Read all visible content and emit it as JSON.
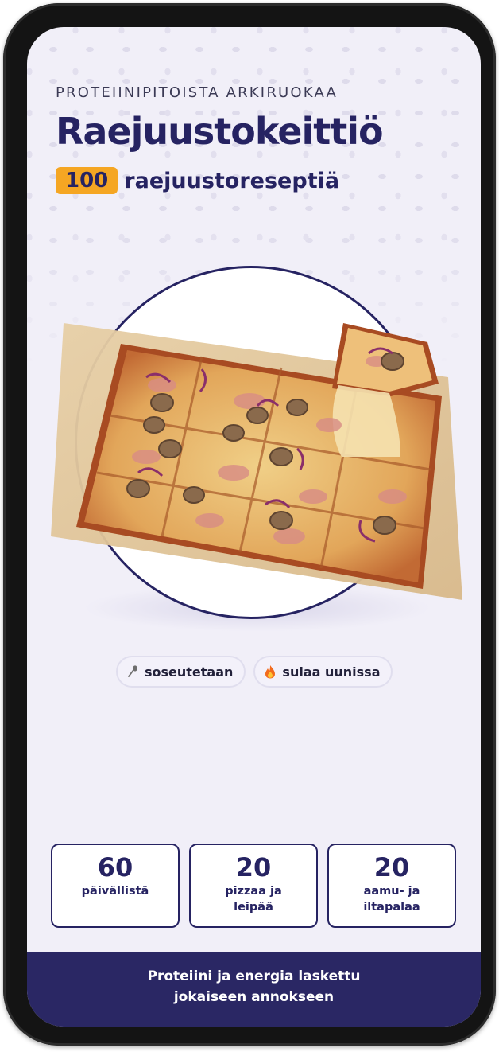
{
  "header": {
    "eyebrow": "PROTEIINIPITOISTA ARKIRUOKAA",
    "title": "Raejuustokeittiö",
    "badge": "100",
    "subtitle": "raejuustoreseptiä"
  },
  "hero": {
    "image": "pizza-on-plate"
  },
  "chips": [
    {
      "icon": "spoon-icon",
      "label": "soseutetaan"
    },
    {
      "icon": "flame-icon",
      "label": "sulaa uunissa"
    }
  ],
  "stats": [
    {
      "value": "60",
      "label": "päivällistä"
    },
    {
      "value": "20",
      "label": "pizzaa ja leipää"
    },
    {
      "value": "20",
      "label": "aamu- ja iltapalaa"
    }
  ],
  "footer": {
    "text": "Proteiini ja energia laskettu jokaiseen annokseen"
  },
  "colors": {
    "brand": "#262362",
    "accent": "#f5a623",
    "background": "#f1eff8",
    "footer": "#2a2764"
  }
}
